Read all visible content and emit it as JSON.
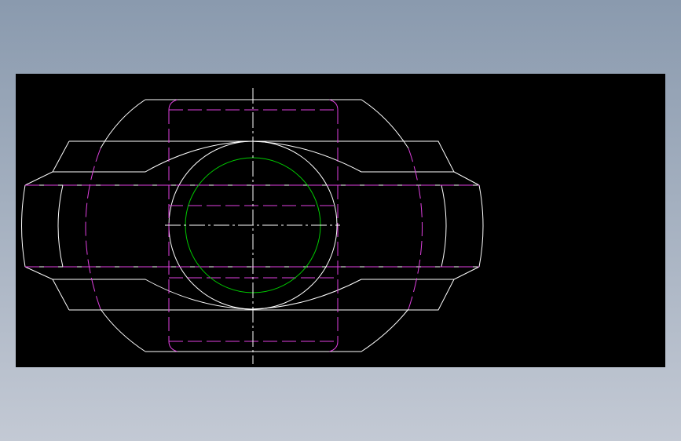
{
  "viewport": {
    "background_color": "#000000"
  },
  "colors": {
    "outline": "#ffffff",
    "hidden": "#e040e0",
    "bore": "#00cc00",
    "centerline": "#ffffff"
  },
  "drawing": {
    "layers": [
      "outline",
      "hidden-lines",
      "bore-circle",
      "centerlines"
    ]
  }
}
